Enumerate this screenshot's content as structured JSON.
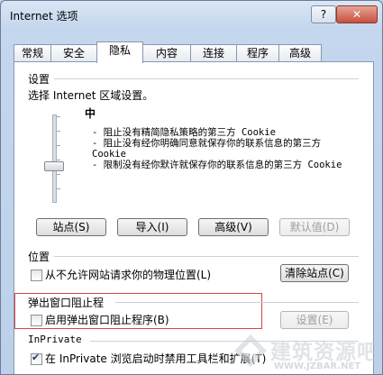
{
  "window": {
    "title": "Internet 选项",
    "help": "?",
    "close": "✕"
  },
  "tabs": [
    {
      "label": "常规"
    },
    {
      "label": "安全"
    },
    {
      "label": "隐私",
      "active": true
    },
    {
      "label": "内容"
    },
    {
      "label": "连接"
    },
    {
      "label": "程序"
    },
    {
      "label": "高级"
    }
  ],
  "settings": {
    "heading": "设置",
    "instruction": "选择 Internet 区域设置。",
    "level": "中",
    "descriptions": [
      "- 阻止没有精简隐私策略的第三方 Cookie",
      "- 阻止没有经你明确同意就保存你的联系信息的第三方 Cookie",
      "- 限制没有经你默许就保存你的联系信息的第三方 Cookie"
    ],
    "buttons": {
      "sites": "站点(S)",
      "import": "导入(I)",
      "advanced": "高级(V)",
      "default": "默认值(D)"
    }
  },
  "location": {
    "heading": "位置",
    "checkbox_label": "从不允许网站请求你的物理位置(L)",
    "clear_button": "清除站点(C)"
  },
  "popup": {
    "heading": "弹出窗口阻止程",
    "checkbox_label": "启用弹出窗口阻止程序(B)",
    "settings_button": "设置(E)"
  },
  "inprivate": {
    "heading": "InPrivate",
    "checkbox_label": "在 InPrivate 浏览启动时禁用工具栏和扩展(T)"
  },
  "watermark": {
    "text": "建筑资源吧",
    "url": "WWW.JZBAR.NET"
  },
  "colors": {
    "highlight_border": "#d04848",
    "window_bg": "#bfd3ea"
  }
}
